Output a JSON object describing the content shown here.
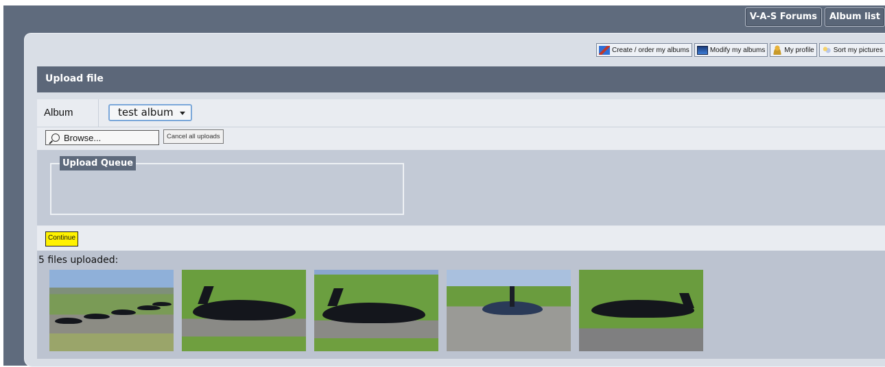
{
  "top_nav": {
    "forums": "V-A-S Forums",
    "album_list": "Album list"
  },
  "toolbar": {
    "create": "Create / order my albums",
    "modify": "Modify my albums",
    "profile": "My profile",
    "sort": "Sort my pictures"
  },
  "upload": {
    "title": "Upload file",
    "album_label": "Album",
    "album_value": "test album",
    "browse": "Browse...",
    "cancel_all": "Cancel all uploads",
    "queue_title": "Upload Queue",
    "continue": "Continue",
    "uploaded_text": "5 files uploaded:"
  },
  "thumbnails": [
    {
      "icon": "jets-lineup-image"
    },
    {
      "icon": "black-jet-taxi-image"
    },
    {
      "icon": "black-jet-taxi-image"
    },
    {
      "icon": "jet-front-view-image"
    },
    {
      "icon": "black-jet-runway-image"
    }
  ],
  "colors": {
    "frame_bg": "#5f6b7d",
    "panel_bg": "#d9dee6",
    "highlight": "#fff200"
  }
}
